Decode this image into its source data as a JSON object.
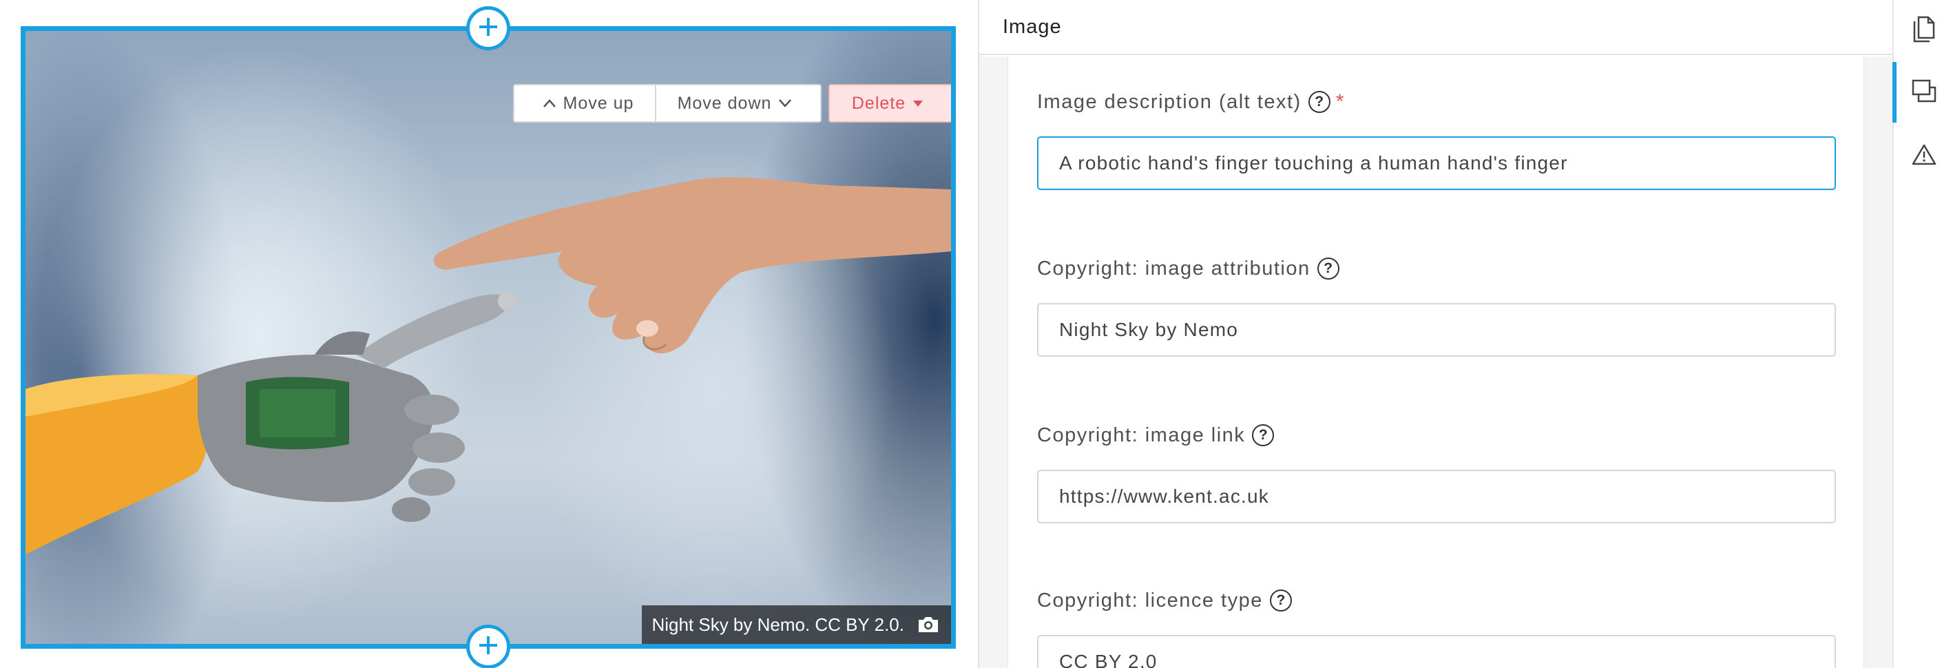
{
  "canvas": {
    "block_toolbar": {
      "move_up_label": "Move up",
      "move_down_label": "Move down",
      "delete_label": "Delete"
    },
    "image": {
      "credit_text": "Night Sky by Nemo. CC BY 2.0."
    },
    "icons": {
      "add_above": "plus-circle-icon",
      "add_below": "plus-circle-icon",
      "camera": "camera-icon"
    }
  },
  "panel": {
    "title": "Image",
    "fields": [
      {
        "label": "Image description (alt text)",
        "required": "*",
        "value": "A robotic hand's finger touching a human hand's finger"
      },
      {
        "label": "Copyright: image attribution",
        "value": "Night Sky by Nemo"
      },
      {
        "label": "Copyright: image link",
        "value": "https://www.kent.ac.uk"
      },
      {
        "label": "Copyright: licence type",
        "value": "CC BY 2.0"
      }
    ],
    "help_glyph": "?"
  },
  "sidebar": {
    "items": [
      {
        "icon": "documents-icon",
        "active": false
      },
      {
        "icon": "block-settings-icon",
        "active": true
      },
      {
        "icon": "warning-icon",
        "active": false
      }
    ]
  },
  "colors": {
    "accent": "#1a9fe0",
    "danger": "#e0505a",
    "danger_bg": "#fde3e3"
  }
}
